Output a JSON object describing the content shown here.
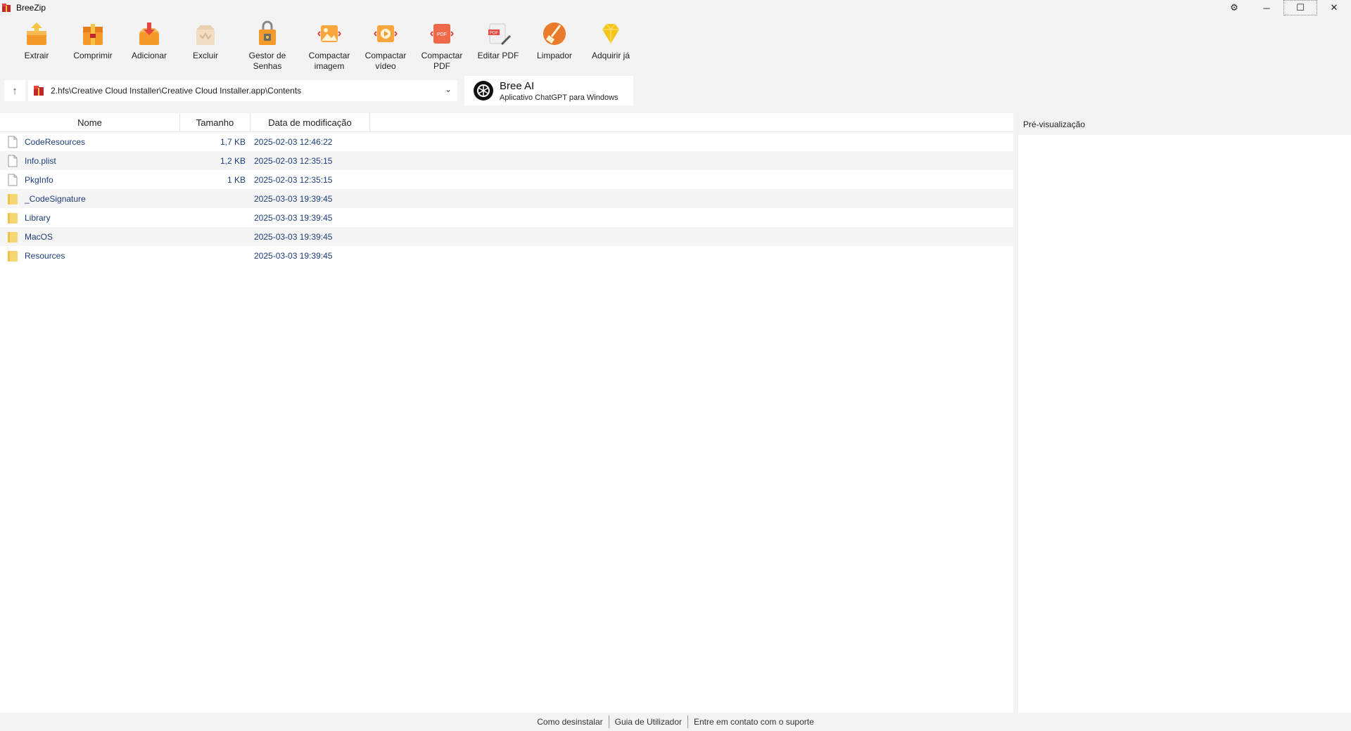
{
  "window": {
    "title": "BreeZip"
  },
  "toolbar": {
    "items": [
      {
        "label": "Extrair",
        "icon": "extract-icon"
      },
      {
        "label": "Comprimir",
        "icon": "compress-icon"
      },
      {
        "label": "Adicionar",
        "icon": "add-icon"
      },
      {
        "label": "Excluir",
        "icon": "delete-icon"
      },
      {
        "label": "Gestor de Senhas",
        "icon": "password-manager-icon"
      },
      {
        "label": "Compactar\nimagem",
        "icon": "compress-image-icon"
      },
      {
        "label": "Compactar\nvídeo",
        "icon": "compress-video-icon"
      },
      {
        "label": "Compactar\nPDF",
        "icon": "compress-pdf-icon"
      },
      {
        "label": "Editar PDF",
        "icon": "edit-pdf-icon"
      },
      {
        "label": "Limpador",
        "icon": "cleaner-icon"
      },
      {
        "label": "Adquirir já",
        "icon": "diamond-icon"
      }
    ],
    "pdf_badge": "PDF"
  },
  "address": {
    "path": "2.hfs\\Creative Cloud Installer\\Creative Cloud Installer.app\\Contents"
  },
  "bree_ai": {
    "title": "Bree AI",
    "subtitle": "Aplicativo ChatGPT para Windows"
  },
  "columns": {
    "name": "Nome",
    "size": "Tamanho",
    "date": "Data de modificação"
  },
  "files": [
    {
      "name": "CodeResources",
      "size": "1,7 KB",
      "date": "2025-02-03 12:46:22",
      "type": "file"
    },
    {
      "name": "Info.plist",
      "size": "1,2 KB",
      "date": "2025-02-03 12:35:15",
      "type": "file"
    },
    {
      "name": "PkgInfo",
      "size": "1 KB",
      "date": "2025-02-03 12:35:15",
      "type": "file"
    },
    {
      "name": "_CodeSignature",
      "size": "",
      "date": "2025-03-03 19:39:45",
      "type": "folder"
    },
    {
      "name": "Library",
      "size": "",
      "date": "2025-03-03 19:39:45",
      "type": "folder"
    },
    {
      "name": "MacOS",
      "size": "",
      "date": "2025-03-03 19:39:45",
      "type": "folder"
    },
    {
      "name": "Resources",
      "size": "",
      "date": "2025-03-03 19:39:45",
      "type": "folder"
    }
  ],
  "preview": {
    "title": "Pré-visualização"
  },
  "footer": {
    "links": [
      "Como desinstalar",
      "Guia de Utilizador",
      "Entre em contato com o suporte"
    ]
  },
  "colors": {
    "accent_orange": "#f39a2b",
    "folder_yellow": "#f7d774",
    "link_blue": "#1c3d7a"
  }
}
